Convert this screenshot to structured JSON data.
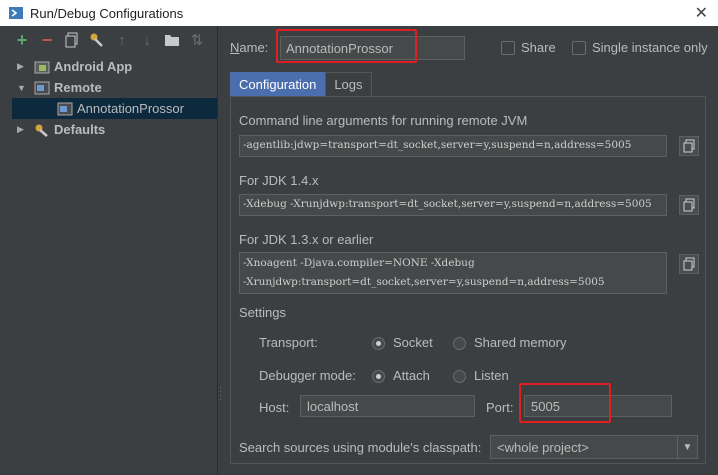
{
  "window": {
    "title": "Run/Debug Configurations"
  },
  "toolbar": {
    "icons": [
      "add-icon",
      "remove-icon",
      "copy-icon",
      "wrench-icon",
      "move-up-icon",
      "move-down-icon",
      "folder-icon",
      "sort-icon"
    ]
  },
  "tree": {
    "items": [
      {
        "label": "Android App",
        "expanded": false
      },
      {
        "label": "Remote",
        "expanded": true
      },
      {
        "label": "AnnotationProssor",
        "selected": true
      },
      {
        "label": "Defaults",
        "expanded": false
      }
    ]
  },
  "config": {
    "name_label_prefix": "N",
    "name_label_rest": "ame:",
    "name_value": "AnnotationProssor",
    "share_label": "Share",
    "single_instance_label": "Single instance only"
  },
  "tabs": [
    {
      "label": "Configuration",
      "active": true
    },
    {
      "label": "Logs",
      "active": false
    }
  ],
  "configuration": {
    "cmd_label": "Command line arguments for running remote JVM",
    "cmd_value": "-agentlib:jdwp=transport=dt_socket,server=y,suspend=n,address=5005",
    "jdk14_label": "For JDK 1.4.x",
    "jdk14_value": "-Xdebug -Xrunjdwp:transport=dt_socket,server=y,suspend=n,address=5005",
    "jdk13_label": "For JDK 1.3.x or earlier",
    "jdk13_line1": "-Xnoagent -Djava.compiler=NONE -Xdebug",
    "jdk13_line2": "-Xrunjdwp:transport=dt_socket,server=y,suspend=n,address=5005",
    "settings_label": "Settings",
    "transport_label": "Transport:",
    "transport_socket": "Socket",
    "transport_shared": "Shared memory",
    "debugger_mode_label": "Debugger mode:",
    "mode_attach": "Attach",
    "mode_listen": "Listen",
    "host_label": "Host:",
    "host_value": "localhost",
    "port_label": "Port:",
    "port_value": "5005",
    "search_label": "Search sources using module's classpath:",
    "search_value": "<whole project>"
  },
  "colors": {
    "highlight": "#e02020",
    "active_tab": "#4b6eaf",
    "selection": "#0d293e"
  }
}
